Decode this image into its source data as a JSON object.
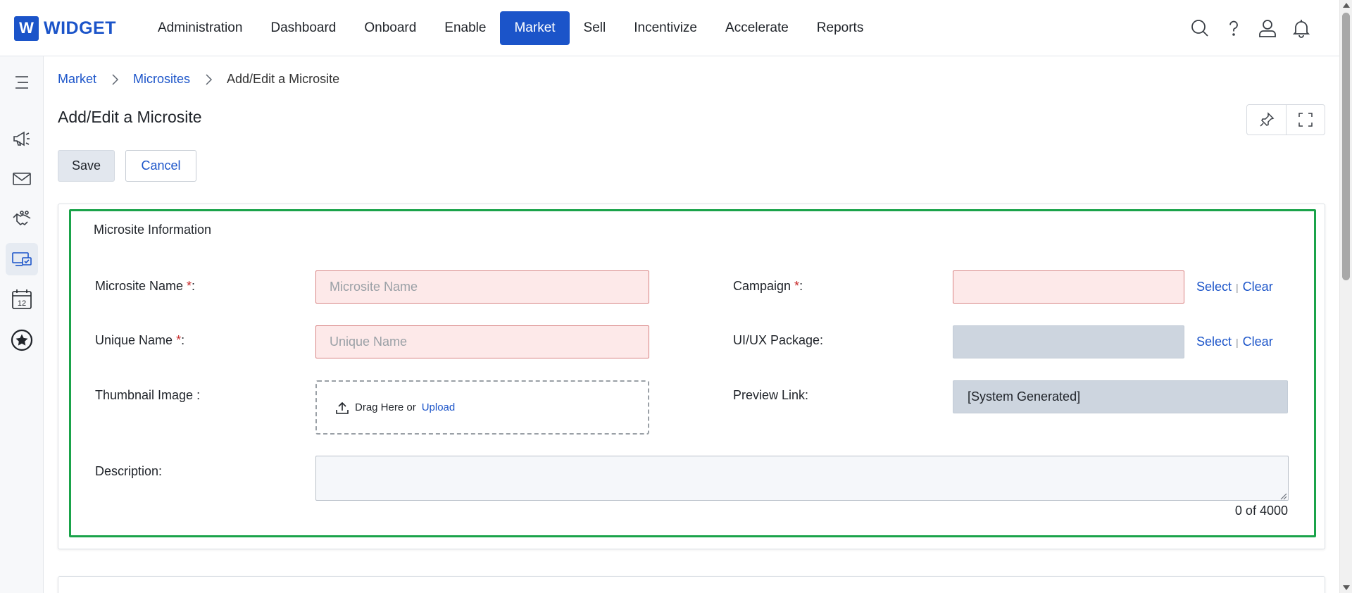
{
  "app": {
    "logo_letter": "W",
    "logo_text": "WIDGET"
  },
  "nav": {
    "items": [
      {
        "label": "Administration"
      },
      {
        "label": "Dashboard"
      },
      {
        "label": "Onboard"
      },
      {
        "label": "Enable"
      },
      {
        "label": "Market"
      },
      {
        "label": "Sell"
      },
      {
        "label": "Incentivize"
      },
      {
        "label": "Accelerate"
      },
      {
        "label": "Reports"
      }
    ],
    "active": "Market"
  },
  "top_icons": [
    "search-icon",
    "help-icon",
    "user-icon",
    "bell-icon"
  ],
  "sidebar": {
    "icons": [
      "menu-icon",
      "megaphone-icon",
      "envelope-icon",
      "handshake-icon",
      "microsite-icon",
      "calendar-icon",
      "star-badge-icon"
    ],
    "calendar_day": "12",
    "active": "microsite-icon"
  },
  "breadcrumb": {
    "items": [
      "Market",
      "Microsites"
    ],
    "current": "Add/Edit a Microsite"
  },
  "page": {
    "title": "Add/Edit a Microsite"
  },
  "toolbar": {
    "save_label": "Save",
    "cancel_label": "Cancel"
  },
  "form": {
    "section_title": "Microsite Information",
    "microsite_name": {
      "label": "Microsite Name ",
      "required_mark": "*",
      "suffix": ":",
      "placeholder": "Microsite Name",
      "value": ""
    },
    "unique_name": {
      "label": "Unique Name ",
      "required_mark": "*",
      "suffix": ":",
      "placeholder": "Unique Name",
      "value": ""
    },
    "thumbnail": {
      "label": "Thumbnail Image :",
      "drag_text": "Drag Here or",
      "upload_label": "Upload"
    },
    "description": {
      "label": "Description:",
      "value": "",
      "char_count": "0 of 4000"
    },
    "campaign": {
      "label": "Campaign ",
      "required_mark": "*",
      "suffix": ":",
      "value": "",
      "select_label": "Select",
      "clear_label": "Clear",
      "separator": "|"
    },
    "uiux_package": {
      "label": "UI/UX Package:",
      "value": "",
      "select_label": "Select",
      "clear_label": "Clear",
      "separator": "|"
    },
    "preview_link": {
      "label": "Preview Link:",
      "value": "[System Generated]"
    }
  },
  "colors": {
    "brand": "#1b54c9",
    "highlight": "#1aa34a",
    "required": "#c62828",
    "error_fill": "#fde9e9"
  }
}
